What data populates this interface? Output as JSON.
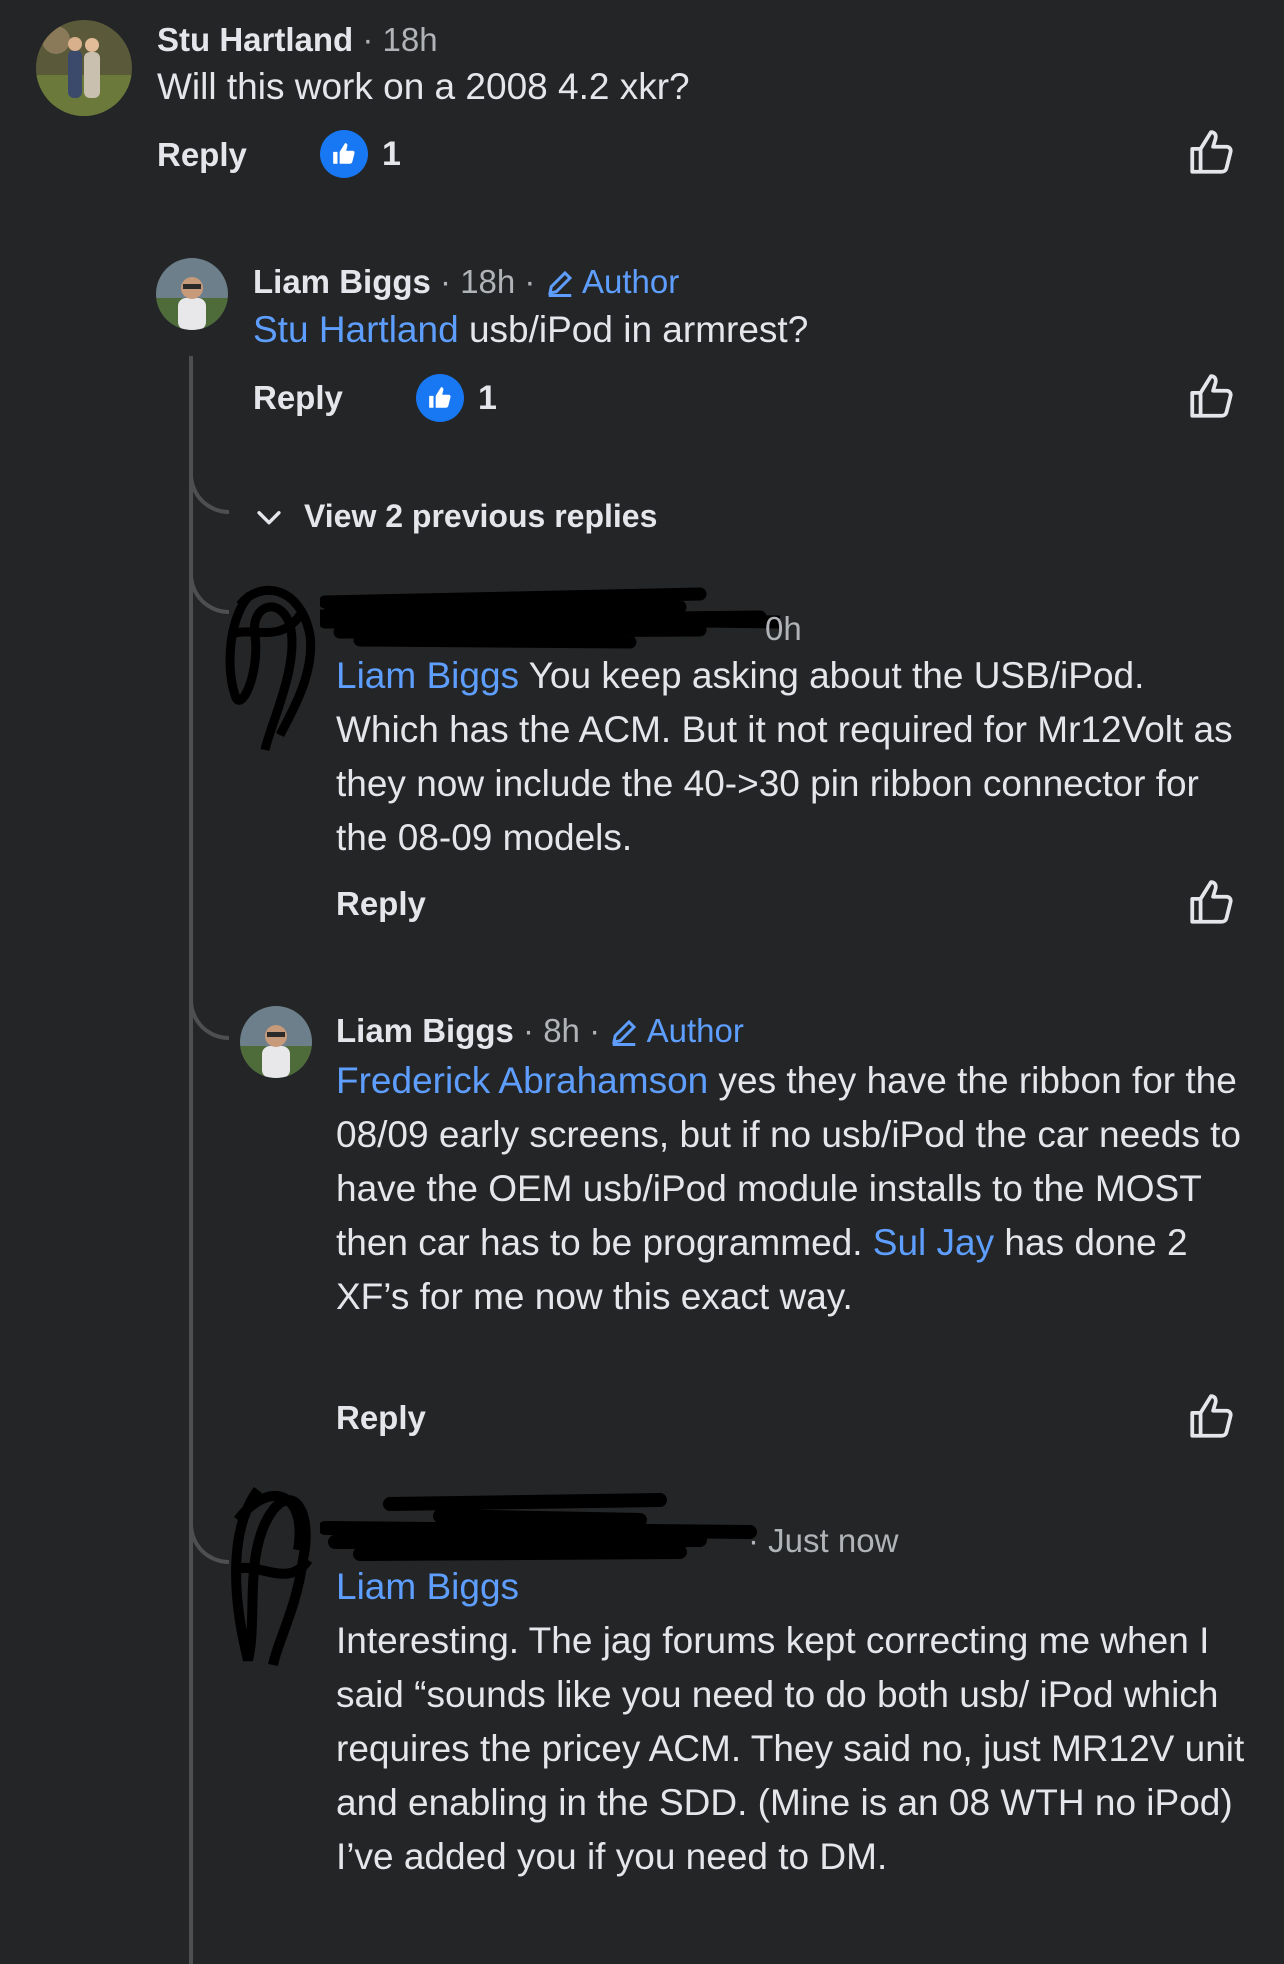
{
  "comments": [
    {
      "name": "Stu Hartland",
      "time": "18h",
      "text": "Will this work on a 2008 4.2 xkr?",
      "reply_label": "Reply",
      "reaction_count": "1"
    },
    {
      "name": "Liam Biggs",
      "time": "18h",
      "author_label": "Author",
      "mention": "Stu Hartland",
      "text": " usb/iPod in armrest?",
      "reply_label": "Reply",
      "reaction_count": "1"
    }
  ],
  "view_previous": "View 2 previous replies",
  "reply3": {
    "time": "0h",
    "mention": "Liam Biggs",
    "text": " You keep asking about the USB/iPod. Which has the ACM. But it not required for Mr12Volt as they now include the 40->30 pin ribbon connector for the 08-09 models.",
    "reply_label": "Reply"
  },
  "reply4": {
    "name": "Liam Biggs",
    "time": "8h",
    "author_label": "Author",
    "mention": "Frederick Abrahamson",
    "text_a": " yes they have the ribbon for the 08/09 early screens, but if no usb/iPod the car needs to have the OEM usb/iPod module installs to the MOST then car has to be programmed. ",
    "mention2": "Sul Jay",
    "text_b": " has done 2 XF’s for me now this exact way.",
    "reply_label": "Reply"
  },
  "reply5": {
    "time": "Just now",
    "mention": "Liam Biggs",
    "text": "Interesting. The jag forums kept correcting me when I said “sounds like you need to do both usb/ iPod which requires the pricey ACM. They said no, just MR12V unit and enabling in the SDD. (Mine is an 08 WTH no iPod) I’ve added you if you need to DM."
  },
  "colors": {
    "background": "#242526",
    "link": "#5e9eff",
    "like_badge": "#1877f2"
  }
}
